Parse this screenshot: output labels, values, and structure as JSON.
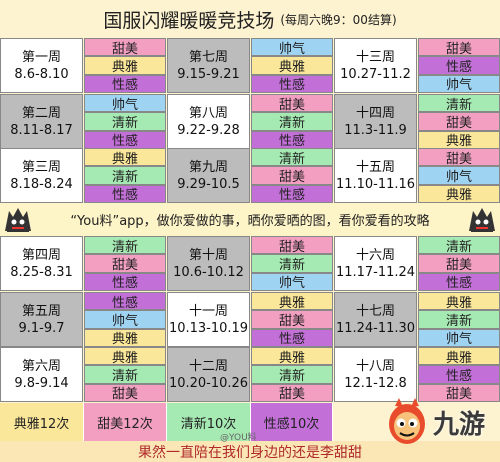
{
  "title": {
    "main": "国服闪耀暖暖竞技场",
    "sub": "(每周六晚9：00结算)"
  },
  "weeks": [
    {
      "label": "第一周",
      "dates": "8.6-8.10",
      "slots": [
        {
          "text": "甜美",
          "type": "sweet"
        },
        {
          "text": "典雅",
          "type": "elegant"
        },
        {
          "text": "性感",
          "type": "sexy"
        }
      ]
    },
    {
      "label": "第二周",
      "dates": "8.11-8.17",
      "slots": [
        {
          "text": "帅气",
          "type": "handsome"
        },
        {
          "text": "清新",
          "type": "fresh"
        },
        {
          "text": "性感",
          "type": "sexy"
        }
      ]
    },
    {
      "label": "第三周",
      "dates": "8.18-8.24",
      "slots": [
        {
          "text": "典雅",
          "type": "elegant"
        },
        {
          "text": "清新",
          "type": "fresh"
        },
        {
          "text": "性感",
          "type": "sexy"
        }
      ]
    },
    {
      "label": "第七周",
      "dates": "9.15-9.21",
      "slots": [
        {
          "text": "帅气",
          "type": "handsome"
        },
        {
          "text": "典雅",
          "type": "elegant"
        },
        {
          "text": "性感",
          "type": "sexy"
        }
      ]
    },
    {
      "label": "第八周",
      "dates": "9.22-9.28",
      "slots": [
        {
          "text": "甜美",
          "type": "sweet"
        },
        {
          "text": "清新",
          "type": "fresh"
        },
        {
          "text": "性感",
          "type": "sexy"
        }
      ]
    },
    {
      "label": "第九周",
      "dates": "9.29-10.5",
      "slots": [
        {
          "text": "清新",
          "type": "fresh"
        },
        {
          "text": "甜美",
          "type": "sweet"
        },
        {
          "text": "性感",
          "type": "sexy"
        }
      ]
    },
    {
      "label": "十三周",
      "dates": "10.27-11.2",
      "slots": [
        {
          "text": "甜美",
          "type": "sweet"
        },
        {
          "text": "性感",
          "type": "sexy"
        },
        {
          "text": "帅气",
          "type": "handsome"
        }
      ]
    },
    {
      "label": "十四周",
      "dates": "11.3-11.9",
      "slots": [
        {
          "text": "清新",
          "type": "fresh"
        },
        {
          "text": "甜美",
          "type": "sweet"
        },
        {
          "text": "典雅",
          "type": "elegant"
        }
      ]
    },
    {
      "label": "十五周",
      "dates": "11.10-11.16",
      "slots": [
        {
          "text": "甜美",
          "type": "sweet"
        },
        {
          "text": "帅气",
          "type": "handsome"
        },
        {
          "text": "典雅",
          "type": "elegant"
        }
      ]
    },
    {
      "label": "第四周",
      "dates": "8.25-8.31",
      "slots": [
        {
          "text": "清新",
          "type": "fresh"
        },
        {
          "text": "甜美",
          "type": "sweet"
        },
        {
          "text": "性感",
          "type": "sexy"
        }
      ]
    },
    {
      "label": "第五周",
      "dates": "9.1-9.7",
      "slots": [
        {
          "text": "性感",
          "type": "sexy"
        },
        {
          "text": "帅气",
          "type": "handsome"
        },
        {
          "text": "典雅",
          "type": "elegant"
        }
      ]
    },
    {
      "label": "第六周",
      "dates": "9.8-9.14",
      "slots": [
        {
          "text": "典雅",
          "type": "elegant"
        },
        {
          "text": "清新",
          "type": "fresh"
        },
        {
          "text": "甜美",
          "type": "sweet"
        }
      ]
    },
    {
      "label": "第十周",
      "dates": "10.6-10.12",
      "slots": [
        {
          "text": "甜美",
          "type": "sweet"
        },
        {
          "text": "清新",
          "type": "fresh"
        },
        {
          "text": "帅气",
          "type": "handsome"
        }
      ]
    },
    {
      "label": "十一周",
      "dates": "10.13-10.19",
      "slots": [
        {
          "text": "典雅",
          "type": "elegant"
        },
        {
          "text": "甜美",
          "type": "sweet"
        },
        {
          "text": "性感",
          "type": "sexy"
        }
      ]
    },
    {
      "label": "十二周",
      "dates": "10.20-10.26",
      "slots": [
        {
          "text": "典雅",
          "type": "elegant"
        },
        {
          "text": "清新",
          "type": "fresh"
        },
        {
          "text": "甜美",
          "type": "sweet"
        }
      ]
    },
    {
      "label": "十六周",
      "dates": "11.17-11.24",
      "slots": [
        {
          "text": "清新",
          "type": "fresh"
        },
        {
          "text": "甜美",
          "type": "sweet"
        },
        {
          "text": "性感",
          "type": "sexy"
        }
      ]
    },
    {
      "label": "十七周",
      "dates": "11.24-11.30",
      "slots": [
        {
          "text": "典雅",
          "type": "elegant"
        },
        {
          "text": "清新",
          "type": "fresh"
        },
        {
          "text": "帅气",
          "type": "handsome"
        }
      ]
    },
    {
      "label": "十八周",
      "dates": "12.1-12.8",
      "slots": [
        {
          "text": "典雅",
          "type": "elegant"
        },
        {
          "text": "性感",
          "type": "sexy"
        },
        {
          "text": "甜美",
          "type": "sweet"
        }
      ]
    }
  ],
  "banner": "“You料”app，做你爱做的事，晒你爱晒的图，看你爱看的攻略",
  "counts": [
    {
      "text": "典雅12次",
      "type": "elegant"
    },
    {
      "text": "甜美12次",
      "type": "sweet"
    },
    {
      "text": "清新10次",
      "type": "fresh"
    },
    {
      "text": "性感10次",
      "type": "sexy"
    }
  ],
  "bottom_note": "果然一直陪在我们身边的还是李甜甜",
  "watermark": "@YOU料",
  "logo": {
    "brand": "九游",
    "icon": "nine-game-mascot"
  },
  "colors": {
    "sweet": "#f39fc1",
    "elegant": "#fbe79a",
    "sexy": "#c36fd8",
    "handsome": "#9ed3f2",
    "fresh": "#a6eab3"
  }
}
